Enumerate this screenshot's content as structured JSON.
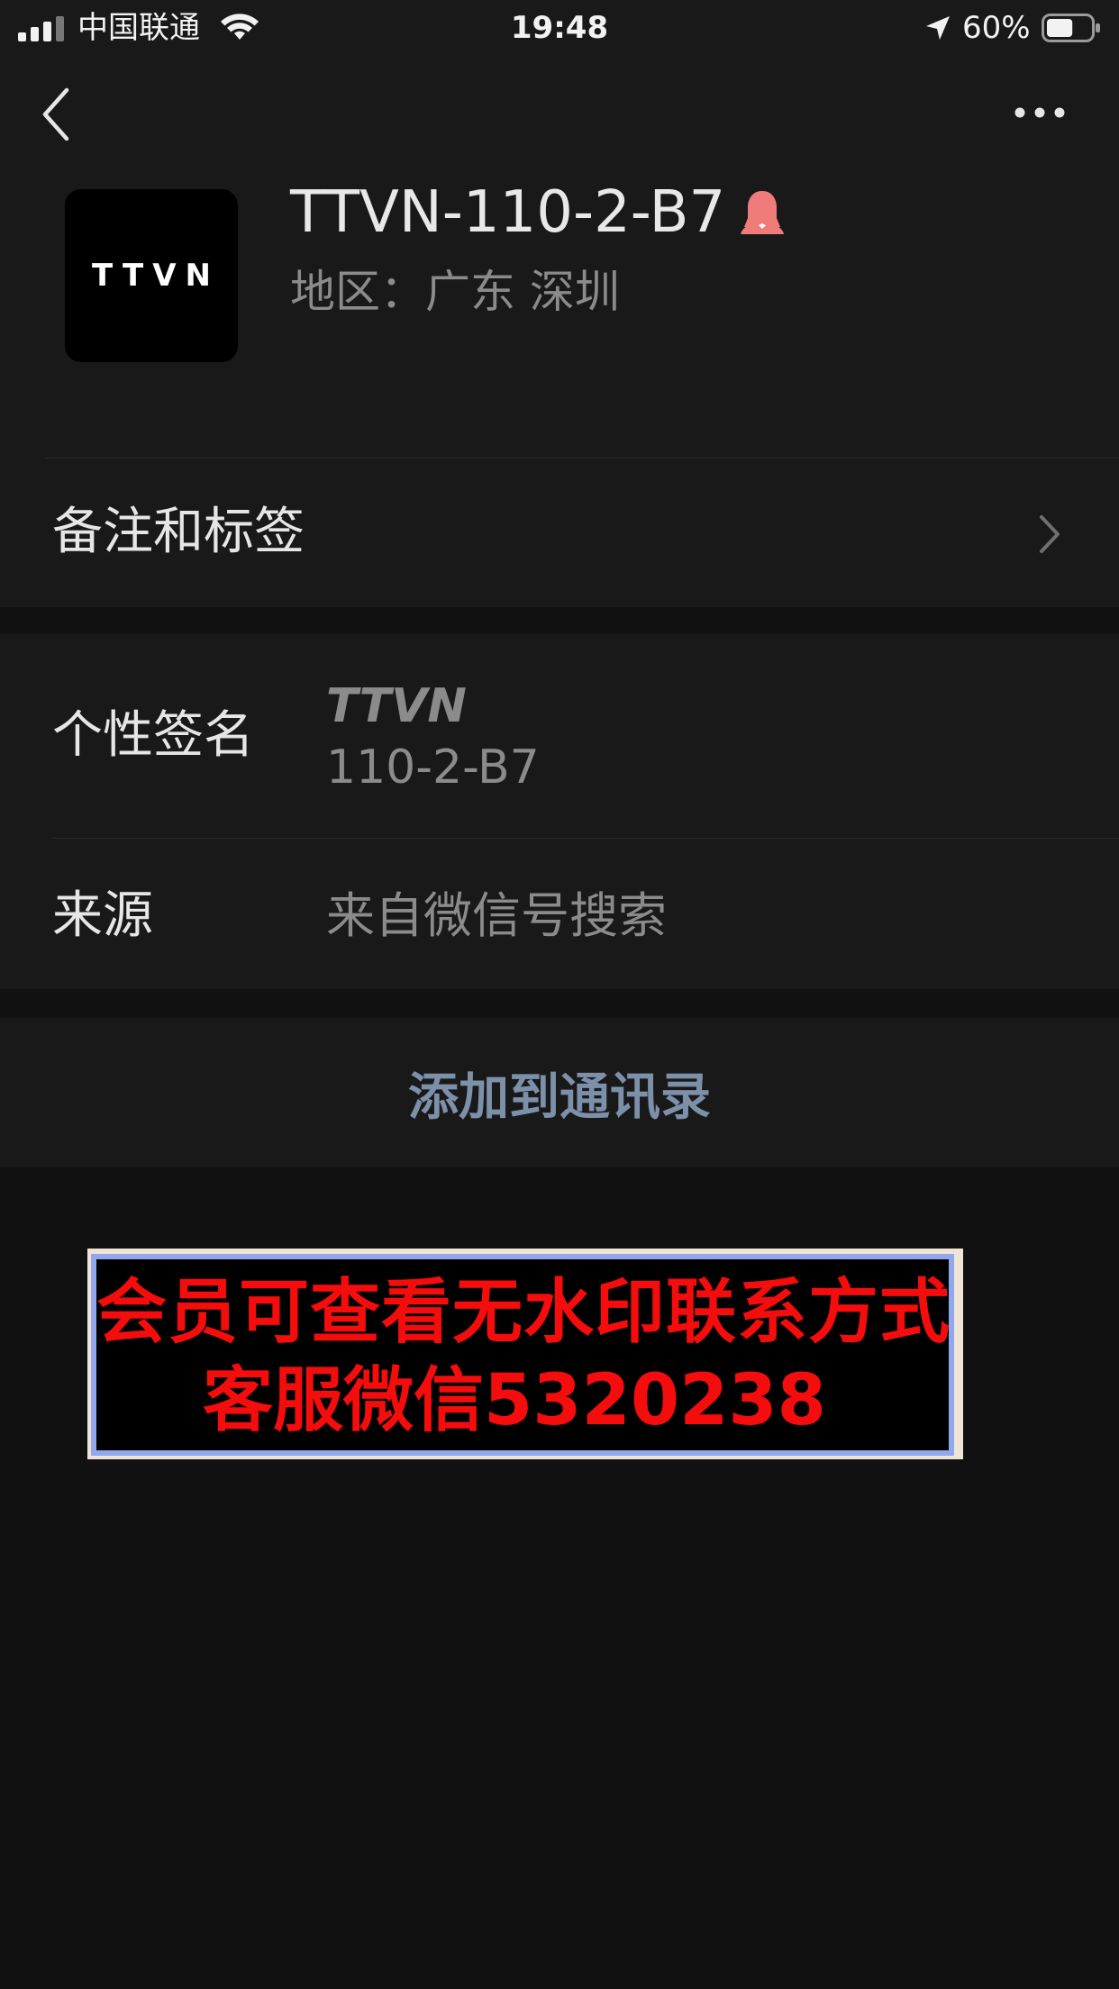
{
  "status_bar": {
    "carrier": "中国联通",
    "time": "19:48",
    "battery_percent": "60%",
    "battery_level": 0.6
  },
  "nav": {
    "back_icon": "chevron-left-icon",
    "more_icon": "more-horizontal-icon"
  },
  "profile": {
    "avatar_text": "TTVN",
    "name": "TTVN-110-2-B7",
    "gender_icon": "female-icon",
    "region": "地区：广东 深圳"
  },
  "remarks": {
    "label": "备注和标签"
  },
  "signature": {
    "label": "个性签名",
    "line1": "TTVN",
    "line2": "110-2-B7"
  },
  "source": {
    "label": "来源",
    "value": "来自微信号搜索"
  },
  "actions": {
    "add_to_contacts": "添加到通讯录"
  },
  "watermark": {
    "line1": "会员可查看无水印联系方式",
    "line2": "客服微信5320238"
  },
  "colors": {
    "background": "#111111",
    "surface": "#191919",
    "link_text": "#7d90a9",
    "watermark_text": "#f50c0c",
    "watermark_border": "#8fa8ee",
    "gender_icon": "#f07b7b"
  }
}
